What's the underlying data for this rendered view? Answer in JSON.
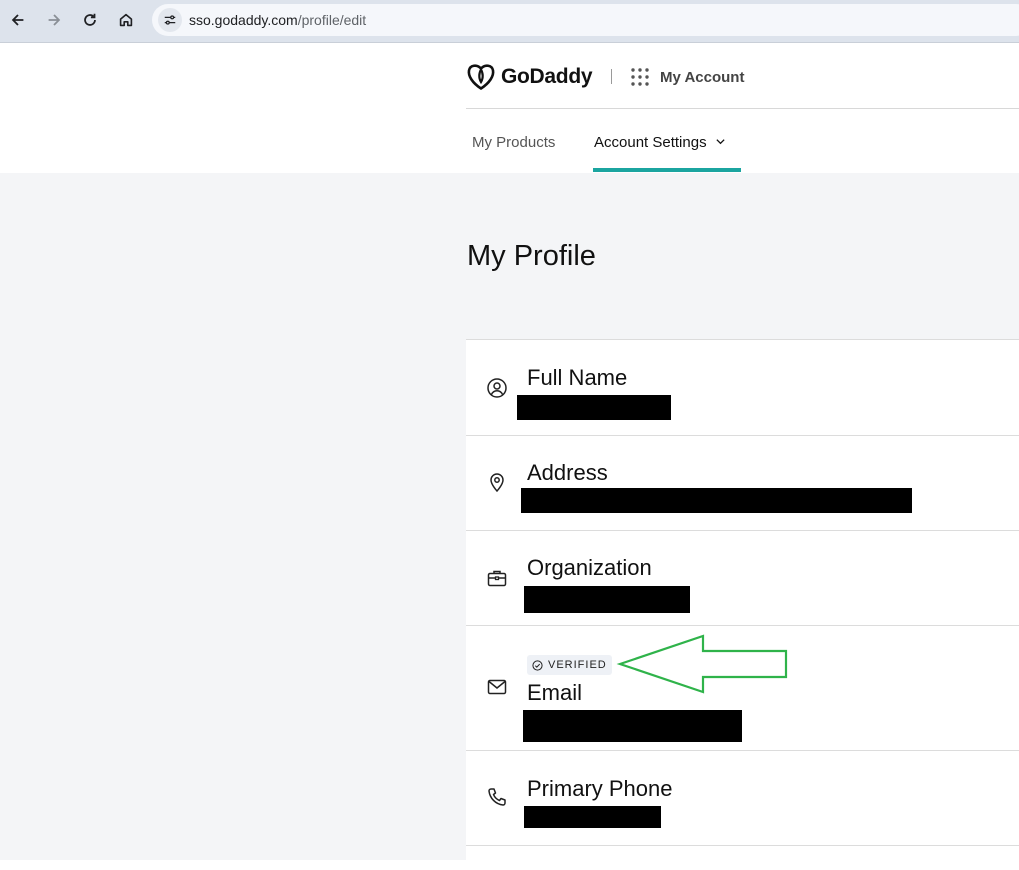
{
  "browser": {
    "url_host": "sso.godaddy.com",
    "url_path": "/profile/edit"
  },
  "header": {
    "brand": "GoDaddy",
    "section": "My Account",
    "tabs": [
      {
        "label": "My Products",
        "active": false
      },
      {
        "label": "Account Settings",
        "active": true
      }
    ]
  },
  "page": {
    "title": "My Profile"
  },
  "profile": {
    "rows": [
      {
        "icon": "person-circle-icon",
        "label": "Full Name"
      },
      {
        "icon": "location-pin-icon",
        "label": "Address"
      },
      {
        "icon": "briefcase-icon",
        "label": "Organization"
      },
      {
        "icon": "envelope-icon",
        "label": "Email",
        "badge": "VERIFIED"
      },
      {
        "icon": "phone-icon",
        "label": "Primary Phone"
      }
    ]
  },
  "colors": {
    "accent": "#1ba5a0",
    "annotation": "#2fb34a",
    "page_bg": "#f4f5f7"
  }
}
